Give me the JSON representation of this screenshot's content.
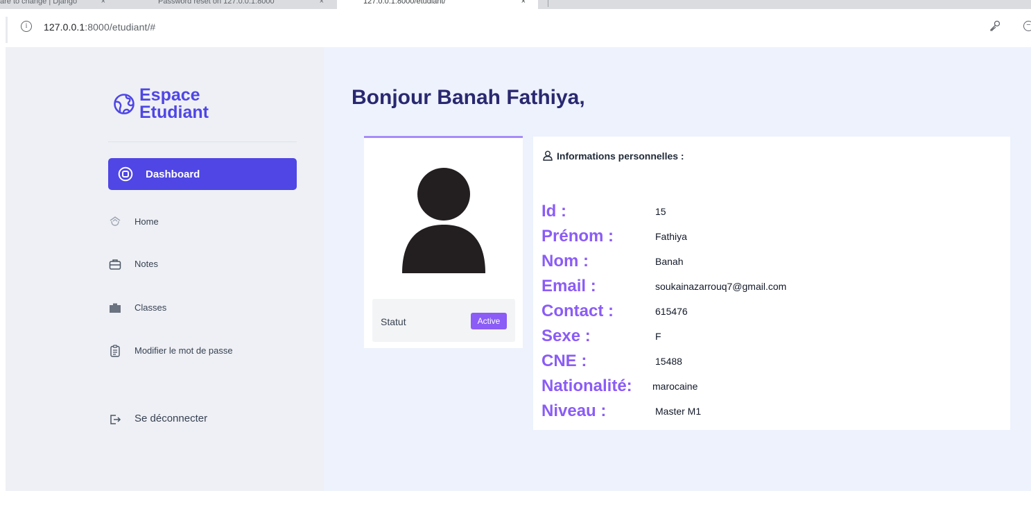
{
  "browser": {
    "tabs": [
      {
        "label": "are to change | Django",
        "close": "×"
      },
      {
        "label": "Password reset on 127.0.0.1:8000",
        "close": "×"
      },
      {
        "label": "127.0.0.1:8000/etudiant/",
        "close": "×"
      }
    ],
    "url_host": "127.0.0.1",
    "url_rest": ":8000/etudiant/#"
  },
  "sidebar": {
    "brand_line1": "Espace",
    "brand_line2": "Etudiant",
    "items": [
      {
        "label": "Dashboard",
        "icon": "dashboard-icon",
        "active": true
      },
      {
        "label": "Home",
        "icon": "home-icon"
      },
      {
        "label": "Notes",
        "icon": "briefcase-icon"
      },
      {
        "label": "Classes",
        "icon": "folder-icon"
      },
      {
        "label": "Modifier le mot de passe",
        "icon": "clipboard-icon"
      }
    ],
    "logout_label": "Se déconnecter"
  },
  "main": {
    "greeting": "Bonjour Banah Fathiya,",
    "profile": {
      "status_label": "Statut",
      "status_value": "Active"
    },
    "info": {
      "title": "Informations personnelles :",
      "fields": [
        {
          "key": "Id :",
          "value": "15"
        },
        {
          "key": "Prénom :",
          "value": "Fathiya"
        },
        {
          "key": "Nom :",
          "value": "Banah"
        },
        {
          "key": "Email :",
          "value": "soukainazarrouq7@gmail.com"
        },
        {
          "key": "Contact :",
          "value": "615476"
        },
        {
          "key": "Sexe :",
          "value": "F"
        },
        {
          "key": "CNE :",
          "value": "15488"
        },
        {
          "key": "Nationalité:",
          "value": "marocaine"
        },
        {
          "key": "Niveau :",
          "value": "Master M1"
        }
      ]
    }
  },
  "colors": {
    "accent": "#4f46e5",
    "label_purple": "#8b5cf6",
    "heading": "#2a2870",
    "page_bg": "#edf2fc",
    "sidebar_bg": "#eef0f5"
  }
}
